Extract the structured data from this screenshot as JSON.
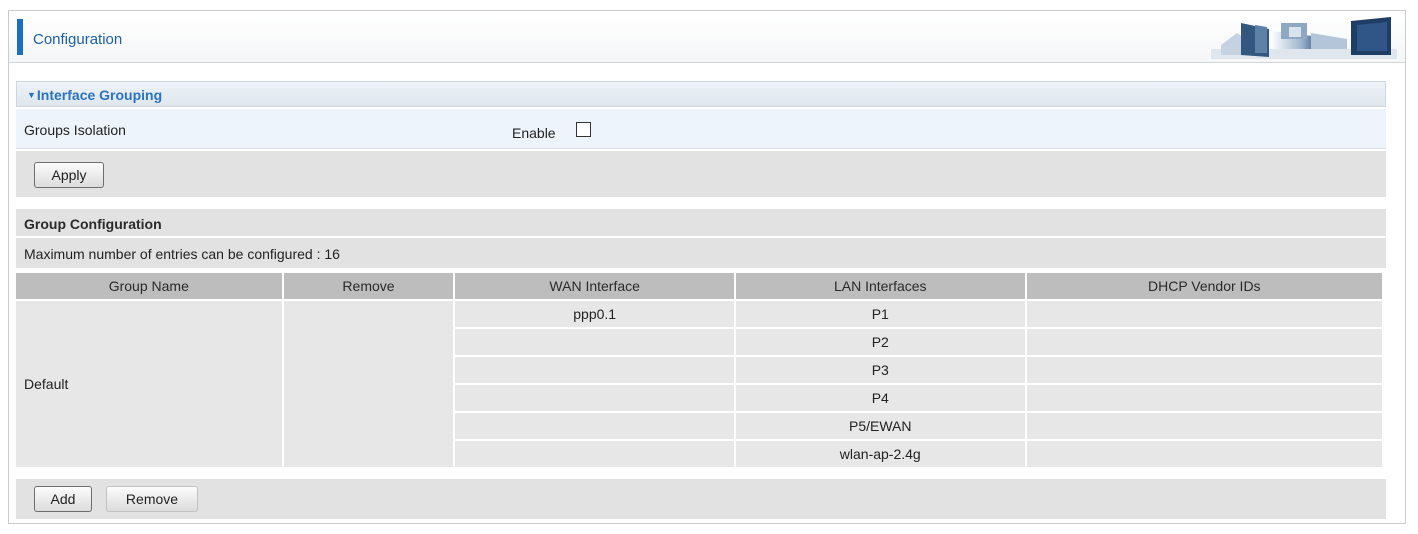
{
  "header": {
    "title": "Configuration"
  },
  "section": {
    "title": "Interface Grouping"
  },
  "isolation": {
    "label": "Groups Isolation",
    "enable_label": "Enable",
    "enabled": false,
    "apply_label": "Apply"
  },
  "group_config": {
    "title": "Group Configuration",
    "max_entries_text": "Maximum number of entries can be configured : 16",
    "columns": [
      "Group Name",
      "Remove",
      "WAN Interface",
      "LAN Interfaces",
      "DHCP Vendor IDs"
    ],
    "group": {
      "name": "Default",
      "remove": "",
      "wan": [
        "ppp0.1",
        "",
        "",
        "",
        "",
        ""
      ],
      "lan": [
        "P1",
        "P2",
        "P3",
        "P4",
        "P5/EWAN",
        "wlan-ap-2.4g"
      ],
      "dhcp": [
        "",
        "",
        "",
        "",
        "",
        ""
      ]
    },
    "add_label": "Add",
    "remove_label": "Remove"
  }
}
